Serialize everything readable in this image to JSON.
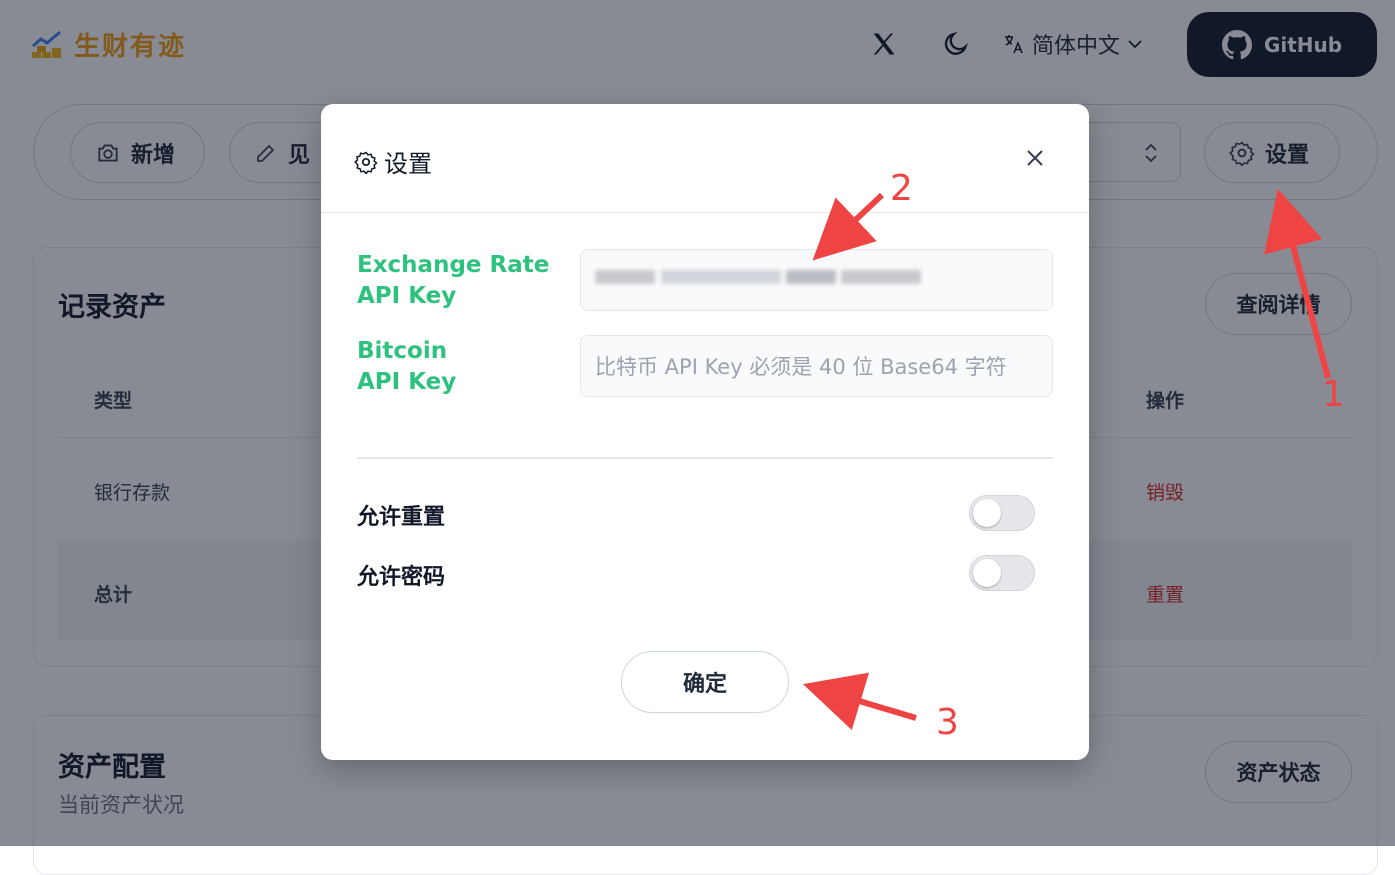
{
  "header": {
    "logo_text": "生财有迹",
    "x_icon": "x-logo-icon",
    "theme_icon": "moon-icon",
    "language": "简体中文",
    "github_label": "GitHub"
  },
  "toolbar": {
    "add_label": "新增",
    "view_label_partial": "见",
    "settings_label": "设置"
  },
  "record_card": {
    "title": "记录资产",
    "details_button": "查阅详情",
    "columns": [
      "类型",
      "操作"
    ],
    "rows": [
      {
        "type": "银行存款",
        "action": "销毁"
      },
      {
        "type": "总计",
        "action": "重置"
      }
    ]
  },
  "allocation_card": {
    "title": "资产配置",
    "subtitle": "当前资产状况",
    "status_button": "资产状态"
  },
  "modal": {
    "title": "设置",
    "exchange_label_line1": "Exchange Rate",
    "exchange_label_line2": "API Key",
    "bitcoin_label_line1": "Bitcoin",
    "bitcoin_label_line2": "API Key",
    "bitcoin_placeholder": "比特币 API Key 必须是 40 位 Base64 字符",
    "allow_reset_label": "允许重置",
    "allow_reset_on": false,
    "allow_password_label": "允许密码",
    "allow_password_on": false,
    "confirm_label": "确定"
  },
  "annotations": {
    "n1": "1",
    "n2": "2",
    "n3": "3"
  },
  "colors": {
    "accent_green": "#2ec27e",
    "danger": "#dc2626",
    "annotation": "#ef4444",
    "github_bg": "#111827"
  }
}
